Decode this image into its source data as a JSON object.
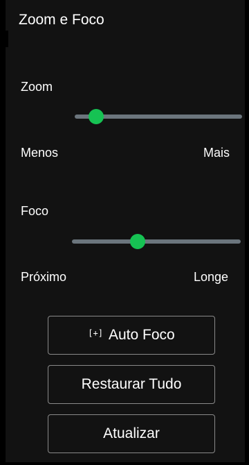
{
  "panel": {
    "title": "Zoom e Foco"
  },
  "zoom": {
    "label": "Zoom",
    "min_label": "Menos",
    "max_label": "Mais",
    "value_fraction": 0.13
  },
  "focus": {
    "label": "Foco",
    "min_label": "Próximo",
    "max_label": "Longe",
    "value_fraction": 0.39
  },
  "buttons": {
    "auto_focus_icon": "[+]",
    "auto_focus_label": "Auto Foco",
    "restore_label": "Restaurar Tudo",
    "refresh_label": "Atualizar"
  },
  "colors": {
    "accent": "#16c253",
    "track": "#6b757d",
    "panel_bg": "#121212",
    "button_border": "#8a8a8a"
  },
  "icons": {
    "auto_focus": "focus-frame-icon"
  }
}
